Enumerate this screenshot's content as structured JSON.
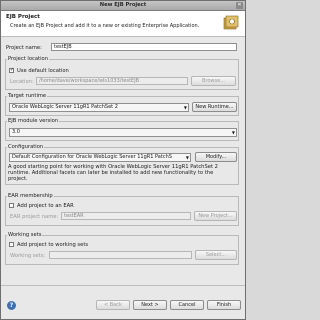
{
  "window": {
    "title": "New EJB Project"
  },
  "header": {
    "title": "EJB Project",
    "description": "Create an EJB Project and add it to a new or existing Enterprise Application."
  },
  "project_name": {
    "label": "Project name:",
    "value": "testEJB"
  },
  "location": {
    "group": "Project location",
    "use_default_label": "Use default location",
    "use_default_checked": true,
    "field_label": "Location:",
    "value": "/home/dave/workspace/wls1033/testEJB",
    "browse_label": "Browse..."
  },
  "runtime": {
    "group": "Target runtime",
    "value": "Oracle WebLogic Server 11gR1 PatchSet 2",
    "new_label": "New Runtime..."
  },
  "module": {
    "group": "EJB module version",
    "value": "3.0"
  },
  "configuration": {
    "group": "Configuration",
    "value": "Default Configuration for Oracle WebLogic Server 11gR1 PatchS",
    "modify_label": "Modify...",
    "info_line1": "A good starting point for working with Oracle WebLogic Server 11gR1 PatchSet 2",
    "info_line2": "runtime. Additional facets can later be installed to add new functionality to the",
    "info_line3": "project."
  },
  "ear": {
    "group": "EAR membership",
    "add_label": "Add project to an EAR",
    "add_checked": false,
    "name_label": "EAR project name:",
    "name_value": "testEAR",
    "new_label": "New Project..."
  },
  "working_sets": {
    "group": "Working sets",
    "add_label": "Add project to working sets",
    "add_checked": false,
    "field_label": "Working sets:",
    "select_label": "Select..."
  },
  "footer": {
    "back_label": "< Back",
    "next_label": "Next >",
    "cancel_label": "Cancel",
    "finish_label": "Finish"
  }
}
